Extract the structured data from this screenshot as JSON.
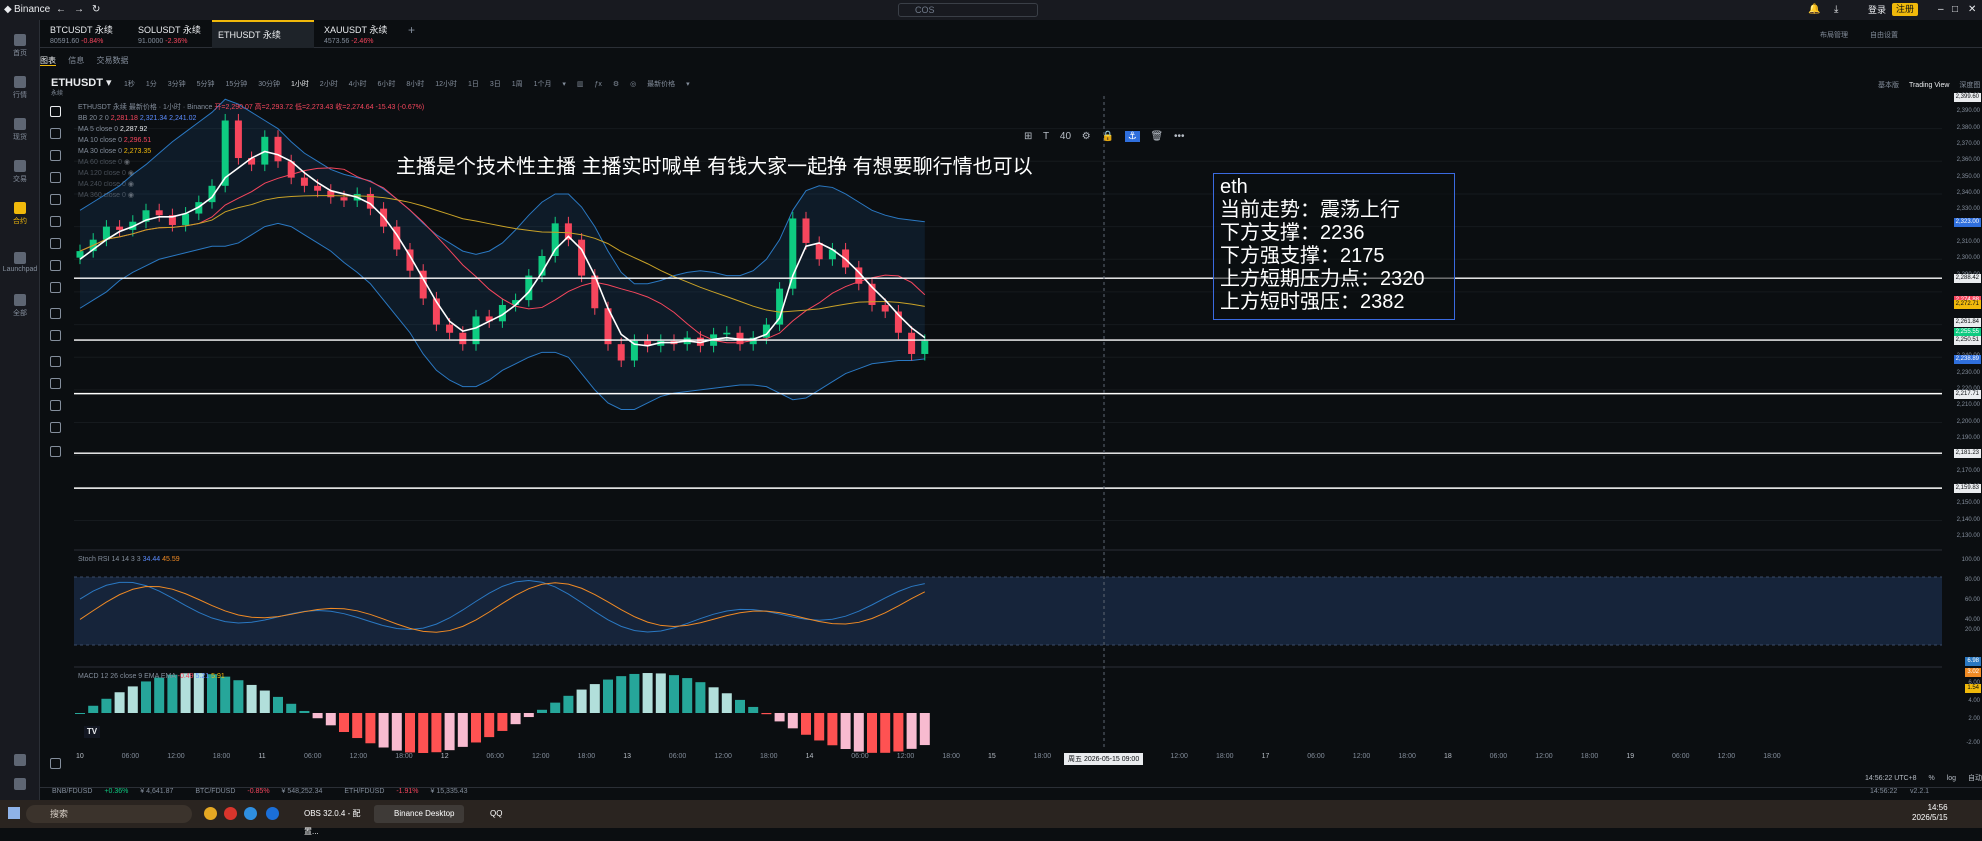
{
  "window": {
    "app_name": "Binance",
    "search_placeholder": "COS",
    "login": "登录",
    "register": "注册",
    "layout_label": "布局管理",
    "custom_label": "自由设置"
  },
  "tabs": [
    {
      "title": "BTCUSDT 永续",
      "price": "80591.60",
      "change": "-0.84%"
    },
    {
      "title": "SOLUSDT 永续",
      "price": "91.0000",
      "change": "-2.36%"
    },
    {
      "title": "ETHUSDT 永续",
      "price": "",
      "change": ""
    },
    {
      "title": "XAUUSDT 永续",
      "price": "4573.56",
      "change": "-2.46%"
    }
  ],
  "nav": [
    "首页",
    "行情",
    "现货",
    "交易",
    "合约",
    "Launchpad",
    "全部"
  ],
  "subtabs": [
    "图表",
    "信息",
    "交易数据"
  ],
  "toolbar": {
    "symbol": "ETHUSDT",
    "symbol_sub": "永续",
    "intervals": [
      "1秒",
      "1分",
      "3分钟",
      "5分钟",
      "15分钟",
      "30分钟",
      "1小时",
      "2小时",
      "4小时",
      "6小时",
      "8小时",
      "12小时",
      "1日",
      "3日",
      "1周",
      "1个月"
    ],
    "active_interval": "1小时",
    "price_mode": "最新价格",
    "views": [
      "基本版",
      "Trading View",
      "深度图"
    ],
    "active_view": "Trading View"
  },
  "legend": {
    "title": "ETHUSDT 永续 最新价格 · 1小时 · Binance",
    "ohlc": "开=2,290.07  高=2,293.72  低=2,273.43  收=2,274.64  -15.43 (-0.67%)",
    "bb": {
      "label": "BB 20 2 0",
      "values": [
        "2,281.18",
        "2,321.34",
        "2,241.02"
      ]
    },
    "ma": [
      {
        "label": "MA 5 close 0",
        "value": "2,287.92"
      },
      {
        "label": "MA 10 close 0",
        "value": "2,296.51"
      },
      {
        "label": "MA 30 close 0",
        "value": "2,273.35"
      },
      {
        "label": "MA 60 close 0",
        "value": ""
      },
      {
        "label": "MA 120 close 0",
        "value": ""
      },
      {
        "label": "MA 240 close 0",
        "value": ""
      },
      {
        "label": "MA 360 close 0",
        "value": ""
      }
    ]
  },
  "banner": "主播是个技术性主播 主播实时喊单 有钱大家一起挣 有想要聊行情也可以",
  "info_box": [
    "eth",
    "当前走势：震荡上行",
    "下方支撑：2236",
    "下方强支撑：2175",
    "上方短期压力点：2320",
    "上方短时强压：2382"
  ],
  "price_axis": [
    "2,399.60",
    "2,390.00",
    "2,380.00",
    "2,370.00",
    "2,360.00",
    "2,350.00",
    "2,340.00",
    "2,330.00",
    "2,310.00",
    "2,300.00",
    "2,290.00",
    "2,270.00",
    "2,260.00",
    "2,240.00",
    "2,230.00",
    "2,220.00",
    "2,210.00",
    "2,200.00",
    "2,190.00",
    "2,180.00",
    "2,170.00",
    "2,160.00",
    "2,150.00",
    "2,140.00",
    "2,130.00"
  ],
  "price_tags": [
    {
      "text": "2,399.60",
      "color": "#eaecef"
    },
    {
      "text": "2,323.00",
      "color": "#2f6fdd"
    },
    {
      "text": "2,288.42",
      "color": "#eaecef"
    },
    {
      "text": "2,274.88",
      "color": "#f6465d"
    },
    {
      "text": "2,272.71",
      "color": "#f0b90b"
    },
    {
      "text": "2,261.84",
      "color": "#eaecef"
    },
    {
      "text": "2,255.55",
      "color": "#0ecb81"
    },
    {
      "text": "2,250.51",
      "color": "#eaecef"
    },
    {
      "text": "2,238.89",
      "color": "#2f6fdd"
    },
    {
      "text": "2,217.71",
      "color": "#eaecef"
    },
    {
      "text": "2,181.23",
      "color": "#eaecef"
    },
    {
      "text": "2,159.83",
      "color": "#eaecef"
    }
  ],
  "horizontal_levels": [
    "2,288.42",
    "2,250.51",
    "2,217.71",
    "2,181.23",
    "2,159.83"
  ],
  "stoch": {
    "label": "Stoch RSI 14 14 3 3",
    "k": "34.44",
    "d": "45.59",
    "axis": [
      "100.00",
      "80.00",
      "60.00",
      "40.00",
      "20.00"
    ],
    "tags": [
      "6.98",
      "3.02"
    ]
  },
  "macd": {
    "label": "MACD 12 26 close 9 EMA EMA",
    "v1": "-0.49",
    "v2": "5.21",
    "v3": "5.91",
    "axis": [
      "6.00",
      "4.00",
      "2.00",
      "-2.00"
    ],
    "tag": "1.54"
  },
  "time_axis": [
    "10",
    "06:00",
    "12:00",
    "18:00",
    "11",
    "06:00",
    "12:00",
    "18:00",
    "12",
    "06:00",
    "12:00",
    "18:00",
    "13",
    "06:00",
    "12:00",
    "18:00",
    "14",
    "06:00",
    "12:00",
    "18:00",
    "15",
    "18:00",
    "16",
    "06:00",
    "12:00",
    "18:00",
    "17",
    "06:00",
    "12:00",
    "18:00",
    "18",
    "06:00",
    "12:00",
    "18:00",
    "19",
    "06:00",
    "12:00",
    "18:00"
  ],
  "time_cursor": "周五 2026-05-15  09:00",
  "bottom_right": {
    "clock": "14:56:22 UTC+8",
    "percent": "%",
    "log": "log",
    "auto": "自动"
  },
  "status_tickers": [
    {
      "pair": "BNB/FDUSD",
      "change": "+0.36%",
      "price": "¥ 4,641.87"
    },
    {
      "pair": "BTC/FDUSD",
      "change": "-0.85%",
      "price": "¥ 548,252.34"
    },
    {
      "pair": "ETH/FDUSD",
      "change": "-1.91%",
      "price": "¥ 15,335.43"
    }
  ],
  "status_time": "14:56:22",
  "status_version": "v2.2.1",
  "taskbar": {
    "search": "搜索",
    "apps": [
      "OBS 32.0.4 - 配置...",
      "Binance Desktop",
      "QQ"
    ],
    "time": "14:56",
    "date": "2026/5/15"
  },
  "chart_data": {
    "type": "candlestick",
    "symbol": "ETHUSDT",
    "interval": "1小时",
    "ylim": [
      2125,
      2400
    ],
    "series": {
      "candles_close": [
        2305,
        2312,
        2320,
        2318,
        2323,
        2330,
        2327,
        2321,
        2328,
        2335,
        2345,
        2385,
        2362,
        2358,
        2375,
        2360,
        2350,
        2345,
        2342,
        2338,
        2336,
        2340,
        2331,
        2320,
        2306,
        2293,
        2276,
        2260,
        2255,
        2248,
        2265,
        2262,
        2272,
        2275,
        2290,
        2302,
        2322,
        2312,
        2290,
        2270,
        2248,
        2238,
        2250,
        2247,
        2250,
        2248,
        2252,
        2247,
        2254,
        2255,
        2248,
        2252,
        2260,
        2282,
        2325,
        2310,
        2300,
        2306,
        2295,
        2285,
        2272,
        2268,
        2255,
        2242,
        2250
      ],
      "ma_white": [
        2300,
        2306,
        2312,
        2317,
        2320,
        2324,
        2326,
        2326,
        2328,
        2332,
        2338,
        2350,
        2356,
        2362,
        2366,
        2364,
        2360,
        2353,
        2347,
        2342,
        2340,
        2338,
        2334,
        2326,
        2315,
        2302,
        2288,
        2274,
        2262,
        2256,
        2258,
        2262,
        2266,
        2272,
        2280,
        2292,
        2306,
        2314,
        2306,
        2290,
        2270,
        2254,
        2248,
        2247,
        2249,
        2249,
        2250,
        2249,
        2251,
        2252,
        2251,
        2251,
        2254,
        2264,
        2290,
        2308,
        2310,
        2306,
        2300,
        2292,
        2283,
        2275,
        2266,
        2258,
        2252
      ],
      "bb_upper": [
        2330,
        2335,
        2340,
        2345,
        2352,
        2358,
        2365,
        2372,
        2378,
        2384,
        2390,
        2398,
        2395,
        2390,
        2385,
        2380,
        2372,
        2365,
        2360,
        2355,
        2352,
        2350,
        2348,
        2343,
        2337,
        2330,
        2322,
        2315,
        2310,
        2305,
        2303,
        2305,
        2310,
        2318,
        2327,
        2335,
        2340,
        2340,
        2332,
        2320,
        2305,
        2292,
        2285,
        2285,
        2287,
        2290,
        2292,
        2293,
        2292,
        2290,
        2290,
        2293,
        2300,
        2312,
        2330,
        2342,
        2345,
        2344,
        2340,
        2335,
        2330,
        2327,
        2325,
        2324,
        2323
      ],
      "bb_lower": [
        2270,
        2275,
        2280,
        2287,
        2292,
        2296,
        2300,
        2302,
        2304,
        2306,
        2308,
        2308,
        2310,
        2315,
        2320,
        2322,
        2320,
        2315,
        2310,
        2305,
        2298,
        2292,
        2285,
        2275,
        2265,
        2255,
        2242,
        2232,
        2226,
        2222,
        2222,
        2226,
        2232,
        2236,
        2240,
        2243,
        2243,
        2240,
        2230,
        2220,
        2212,
        2208,
        2208,
        2212,
        2216,
        2218,
        2219,
        2220,
        2221,
        2222,
        2223,
        2223,
        2222,
        2218,
        2214,
        2215,
        2220,
        2225,
        2230,
        2233,
        2236,
        2237,
        2238,
        2238,
        2239
      ]
    }
  }
}
